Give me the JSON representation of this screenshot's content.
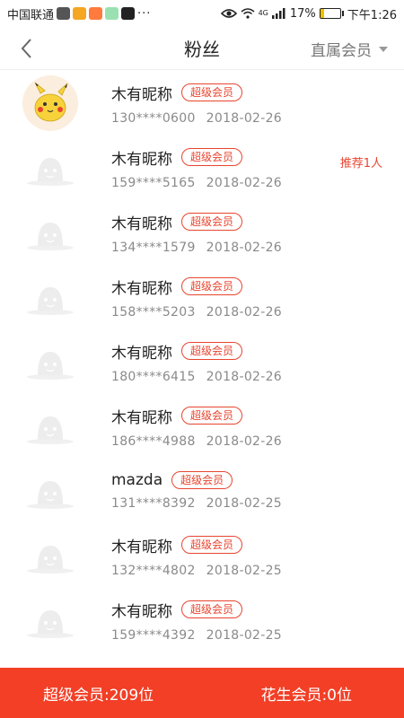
{
  "status_bar": {
    "carrier": "中国联通",
    "dots": "···",
    "network": "4G",
    "battery": "17%",
    "time": "下午1:26",
    "battery_level": 0.17
  },
  "nav": {
    "title": "粉丝",
    "filter_label": "直属会员"
  },
  "members": [
    {
      "name": "木有昵称",
      "badge": "超级会员",
      "phone": "130****0600",
      "date": "2018-02-26",
      "recommend": "",
      "avatar": "pikachu"
    },
    {
      "name": "木有昵称",
      "badge": "超级会员",
      "phone": "159****5165",
      "date": "2018-02-26",
      "recommend": "推荐1人",
      "avatar": "default"
    },
    {
      "name": "木有昵称",
      "badge": "超级会员",
      "phone": "134****1579",
      "date": "2018-02-26",
      "recommend": "",
      "avatar": "default"
    },
    {
      "name": "木有昵称",
      "badge": "超级会员",
      "phone": "158****5203",
      "date": "2018-02-26",
      "recommend": "",
      "avatar": "default"
    },
    {
      "name": "木有昵称",
      "badge": "超级会员",
      "phone": "180****6415",
      "date": "2018-02-26",
      "recommend": "",
      "avatar": "default"
    },
    {
      "name": "木有昵称",
      "badge": "超级会员",
      "phone": "186****4988",
      "date": "2018-02-26",
      "recommend": "",
      "avatar": "default"
    },
    {
      "name": "mazda",
      "badge": "超级会员",
      "phone": "131****8392",
      "date": "2018-02-25",
      "recommend": "",
      "avatar": "default"
    },
    {
      "name": "木有昵称",
      "badge": "超级会员",
      "phone": "132****4802",
      "date": "2018-02-25",
      "recommend": "",
      "avatar": "default"
    },
    {
      "name": "木有昵称",
      "badge": "超级会员",
      "phone": "159****4392",
      "date": "2018-02-25",
      "recommend": "",
      "avatar": "default"
    }
  ],
  "footer": {
    "super_members": "超级会员:209位",
    "peanut_members": "花生会员:0位"
  },
  "colors": {
    "accent": "#f23f26",
    "badge": "#e8452f"
  }
}
